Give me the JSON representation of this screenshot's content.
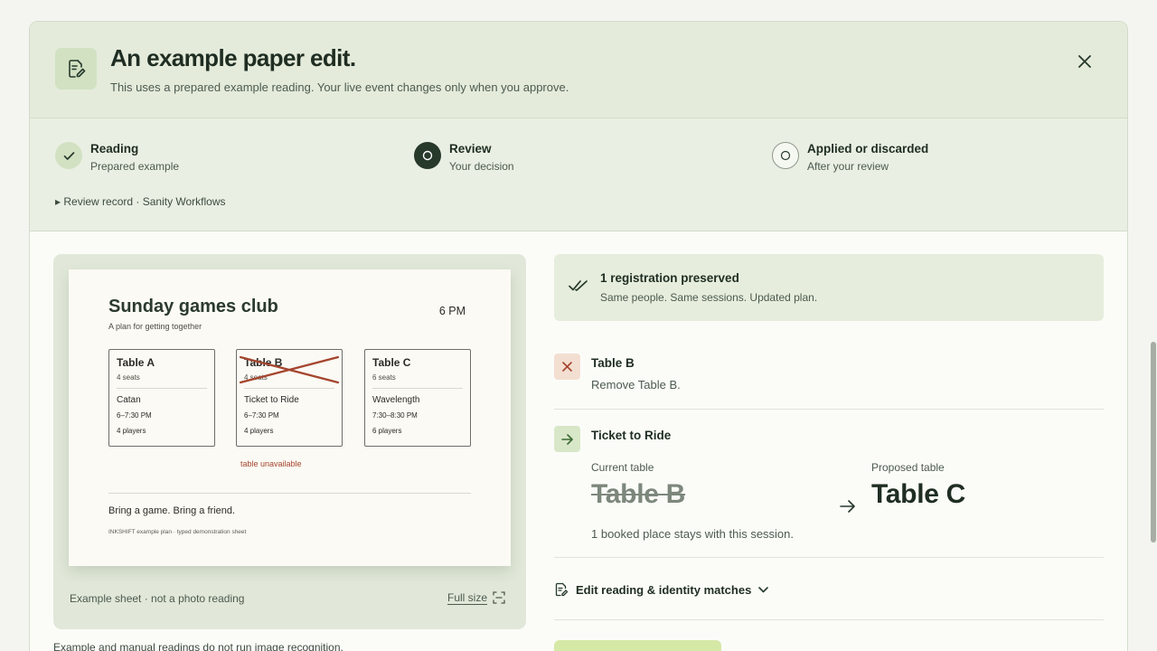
{
  "header": {
    "title": "An example paper edit.",
    "subtitle": "This uses a prepared example reading. Your live event changes only when you approve.",
    "icon": "edit-document-icon",
    "close_icon": "close-icon"
  },
  "steps": [
    {
      "title": "Reading",
      "sub": "Prepared example",
      "state": "done"
    },
    {
      "title": "Review",
      "sub": "Your decision",
      "state": "active"
    },
    {
      "title": "Applied or discarded",
      "sub": "After your review",
      "state": "pending"
    }
  ],
  "review_record": "▸ Review record · Sanity Workflows",
  "sheet": {
    "title": "Sunday games club",
    "subtitle": "A plan for getting together",
    "time": "6 PM",
    "tables": [
      {
        "name": "Table A",
        "seats": "4 seats",
        "game": "Catan",
        "time": "6–7:30 PM",
        "players": "4 players"
      },
      {
        "name": "Table B",
        "seats": "4 seats",
        "game": "Ticket to Ride",
        "time": "6–7:30 PM",
        "players": "4 players"
      },
      {
        "name": "Table C",
        "seats": "6 seats",
        "game": "Wavelength",
        "time": "7:30–8:30 PM",
        "players": "6 players"
      }
    ],
    "unavailable": "table unavailable",
    "footer": "Bring a game. Bring a friend.",
    "note": "INKSHIFT example plan · typed demonstration sheet"
  },
  "preview": {
    "caption": "Example sheet · not a photo reading",
    "fullsize": "Full size",
    "manual_note": "Example and manual readings do not run image recognition."
  },
  "preserved": {
    "title": "1 registration preserved",
    "sub": "Same people. Same sessions. Updated plan."
  },
  "changes": {
    "remove": {
      "title": "Table B",
      "sub": "Remove Table B."
    },
    "move": {
      "title": "Ticket to Ride",
      "current_label": "Current table",
      "current_value": "Table B",
      "proposed_label": "Proposed table",
      "proposed_value": "Table C",
      "stays": "1 booked place stays with this session."
    }
  },
  "edit_reading": "Edit reading & identity matches",
  "colors": {
    "accent": "#26392b",
    "header_bg": "#e4ebdb",
    "remove_badge": "#f3dfd1",
    "move_badge": "#d8e7c8",
    "approve": "#d6e8a6",
    "strike": "#a5452e"
  }
}
